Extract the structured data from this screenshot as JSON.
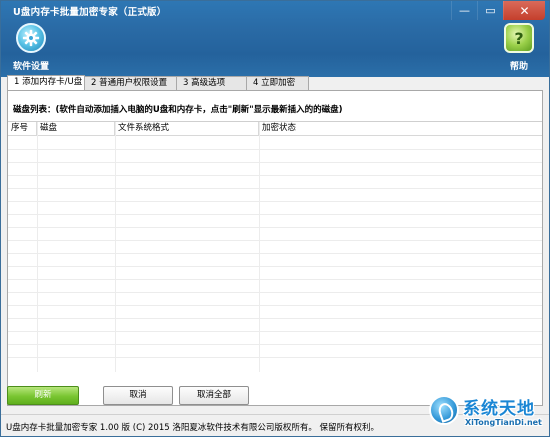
{
  "window": {
    "title": "U盘内存卡批量加密专家（正式版）",
    "minimize_glyph": "—",
    "restore_glyph": "▭",
    "close_glyph": "✕"
  },
  "toolbar": {
    "settings_label": "软件设置",
    "settings_icon": "gear-icon",
    "help_label": "帮助",
    "help_icon": "question-icon",
    "help_glyph": "?"
  },
  "tabs": [
    {
      "label": "1 添加内存卡/U盘",
      "active": true
    },
    {
      "label": "2 普通用户权限设置",
      "active": false
    },
    {
      "label": "3 高级选项",
      "active": false
    },
    {
      "label": "4 立即加密",
      "active": false
    }
  ],
  "panel": {
    "caption": "磁盘列表：(软件自动添加插入电脑的U盘和内存卡，点击\"刷新\"显示最新插入的的磁盘)"
  },
  "table": {
    "columns": [
      "序号",
      "磁盘",
      "文件系统格式",
      "加密状态"
    ],
    "rows": []
  },
  "buttons": {
    "refresh": "刷新",
    "cancel": "取消",
    "cancel_all": "取消全部"
  },
  "statusbar": {
    "text": "U盘内存卡批量加密专家 1.00 版  (C)  2015 洛阳夏冰软件技术有限公司版权所有。 保留所有权利。"
  },
  "watermark": {
    "title": "系统天地",
    "url": "XiTongTianDi.net"
  },
  "colors": {
    "titlebar": "#2a6ba6",
    "primary_button": "#79c531",
    "watermark": "#1a86d4"
  }
}
